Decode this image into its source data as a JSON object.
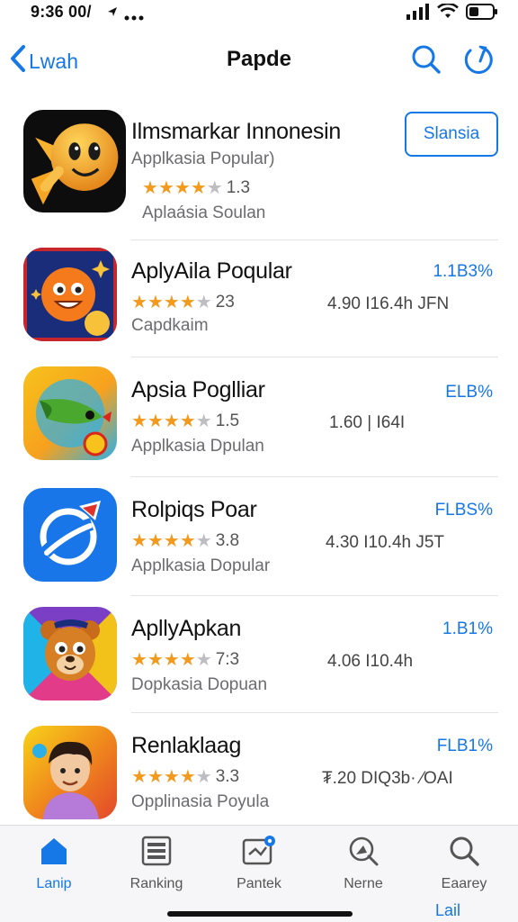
{
  "status_bar": {
    "time": "9:36 00/"
  },
  "nav": {
    "back_label": "Lwah",
    "title": "Papde"
  },
  "apps": [
    {
      "title": "Ilmsmarkar Innonesin",
      "subtitle": "Applkasia Popular)",
      "stars": 4.5,
      "rating_text": "1.3",
      "subtitle2": "Aplaásia Soulan",
      "button_label": "Slansia"
    },
    {
      "title": "AplyAila Poqular",
      "stars": 4.5,
      "rating_text": "23",
      "subtitle": "Capdkaim",
      "meta": "4.90 I16.4h   JFN",
      "price": "1.1B3%"
    },
    {
      "title": "Apsia Poglliar",
      "stars": 4.5,
      "rating_text": "1.5",
      "subtitle": "Applkasia Dpulan",
      "meta": "1.60 | I64I",
      "price": "ELB%"
    },
    {
      "title": "Rolpiqs Poar",
      "stars": 4.5,
      "rating_text": "3.8",
      "subtitle": "Applkasia Dopular",
      "meta": "4.30 I10.4h   J5T",
      "price": "FLBS%"
    },
    {
      "title": "ApllyApkan",
      "stars": 4.5,
      "rating_text": "7:3",
      "subtitle": "Dopkasia Dopuan",
      "meta": "4.06 I10.4h",
      "price": "1.B1%"
    },
    {
      "title": "Renlaklaag",
      "stars": 4.5,
      "rating_text": "3.3",
      "subtitle": "Opplinasia Poyula",
      "meta": "₮.20 DIQ3b· ⁄OAI",
      "price": "FLB1%"
    }
  ],
  "tabs": [
    {
      "label": "Lanip",
      "icon": "home-icon",
      "active": true
    },
    {
      "label": "Ranking",
      "icon": "ranking-icon",
      "active": false
    },
    {
      "label": "Pantek",
      "icon": "updates-icon",
      "active": false
    },
    {
      "label": "Nerne",
      "icon": "search-doc-icon",
      "active": false
    },
    {
      "label": "Eaarey",
      "icon": "search-icon",
      "active": false
    }
  ],
  "tab_extra": "Lail",
  "colors": {
    "accent": "#1677e6",
    "star": "#f29a1d",
    "text": "#111111",
    "secondary": "#6b6b70"
  }
}
